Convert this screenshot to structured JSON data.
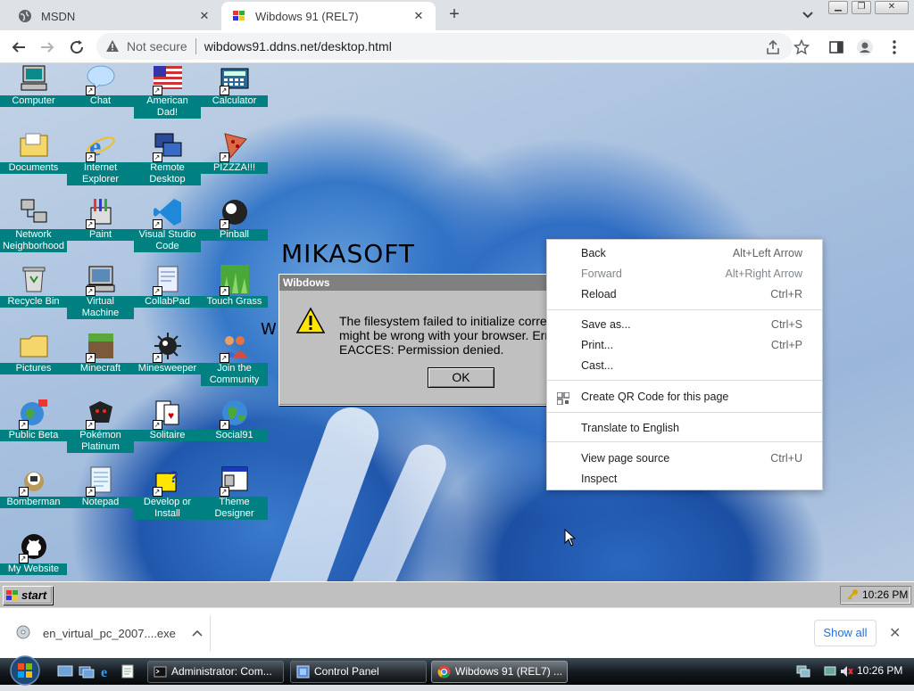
{
  "browser": {
    "tabs": [
      {
        "title": "MSDN",
        "active": false
      },
      {
        "title": "Wibdows 91 (REL7)",
        "active": true
      }
    ],
    "security_label": "Not secure",
    "url": "wibdows91.ddns.net/desktop.html"
  },
  "desktop": {
    "background_text": "MIKASOFT",
    "background_text2": "W",
    "icons": [
      {
        "label": "Computer",
        "icon": "computer-icon"
      },
      {
        "label": "Chat",
        "icon": "chat-bubble-icon"
      },
      {
        "label": "American Dad!",
        "icon": "us-flag-icon"
      },
      {
        "label": "Calculator",
        "icon": "calculator-icon"
      },
      {
        "label": "Documents",
        "icon": "folder-documents-icon"
      },
      {
        "label": "Internet Explorer",
        "icon": "internet-explorer-icon"
      },
      {
        "label": "Remote Desktop",
        "icon": "remote-desktop-icon"
      },
      {
        "label": "PIZZZA!!!",
        "icon": "pizza-icon"
      },
      {
        "label": "Network Neighborhood",
        "icon": "network-icon"
      },
      {
        "label": "Paint",
        "icon": "paint-icon"
      },
      {
        "label": "Visual Studio Code",
        "icon": "vscode-icon"
      },
      {
        "label": "Pinball",
        "icon": "pinball-icon"
      },
      {
        "label": "Recycle Bin",
        "icon": "recycle-bin-icon"
      },
      {
        "label": "Virtual Machine",
        "icon": "virtual-machine-icon"
      },
      {
        "label": "CollabPad",
        "icon": "collabpad-icon"
      },
      {
        "label": "Touch Grass",
        "icon": "grass-icon"
      },
      {
        "label": "Pictures",
        "icon": "folder-icon"
      },
      {
        "label": "Minecraft",
        "icon": "minecraft-icon"
      },
      {
        "label": "Minesweeper",
        "icon": "mine-icon"
      },
      {
        "label": "Join the Community",
        "icon": "community-icon"
      },
      {
        "label": "Public Beta",
        "icon": "globe-flag-icon"
      },
      {
        "label": "Pokémon Platinum",
        "icon": "pokemon-icon"
      },
      {
        "label": "Solitaire",
        "icon": "solitaire-icon"
      },
      {
        "label": "Social91",
        "icon": "globe-icon"
      },
      {
        "label": "Bomberman",
        "icon": "bomberman-icon"
      },
      {
        "label": "Notepad",
        "icon": "notepad-icon"
      },
      {
        "label": "Develop or Install",
        "icon": "help-icon"
      },
      {
        "label": "Theme Designer",
        "icon": "theme-designer-icon"
      },
      {
        "label": "My Website",
        "icon": "github-icon"
      }
    ]
  },
  "dialog": {
    "title": "Wibdows",
    "line1": "The filesystem failed to initialize corre",
    "line2": "might be wrong with your browser. Err",
    "line3": "EACCES: Permission denied.",
    "ok_label": "OK"
  },
  "context_menu": {
    "items": [
      {
        "label": "Back",
        "shortcut": "Alt+Left Arrow"
      },
      {
        "label": "Forward",
        "shortcut": "Alt+Right Arrow",
        "disabled": true
      },
      {
        "label": "Reload",
        "shortcut": "Ctrl+R"
      },
      {
        "label": "Save as...",
        "shortcut": "Ctrl+S"
      },
      {
        "label": "Print...",
        "shortcut": "Ctrl+P"
      },
      {
        "label": "Cast...",
        "shortcut": ""
      },
      {
        "label": "Create QR Code for this page",
        "shortcut": ""
      },
      {
        "label": "Translate to English",
        "shortcut": ""
      },
      {
        "label": "View page source",
        "shortcut": "Ctrl+U"
      },
      {
        "label": "Inspect",
        "shortcut": ""
      }
    ]
  },
  "wibdows_taskbar": {
    "start_label": "start",
    "clock": "10:26 PM"
  },
  "downloads": {
    "filename": "en_virtual_pc_2007....exe",
    "show_all": "Show all"
  },
  "os_taskbar": {
    "buttons": [
      {
        "label": "Administrator: Com...",
        "icon": "cmd-icon"
      },
      {
        "label": "Control Panel",
        "icon": "control-panel-icon"
      },
      {
        "label": "Wibdows 91 (REL7) ...",
        "icon": "chrome-icon",
        "active": true
      }
    ],
    "clock": "10:26 PM"
  },
  "colors": {
    "desktop_label_bg": "#008080",
    "win95_gray": "#c0c0c0",
    "chrome_accent": "#1a73e8"
  }
}
